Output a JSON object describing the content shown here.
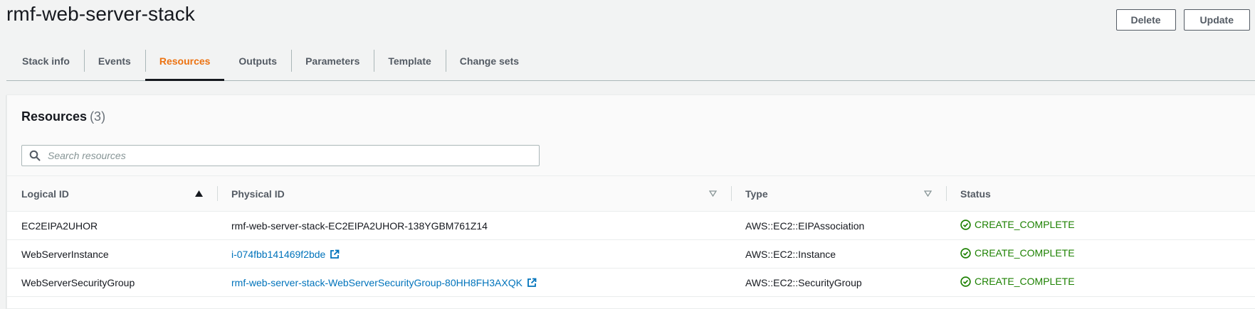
{
  "page": {
    "title": "rmf-web-server-stack"
  },
  "actions": {
    "delete_label": "Delete",
    "update_label": "Update"
  },
  "tabs": [
    {
      "label": "Stack info"
    },
    {
      "label": "Events"
    },
    {
      "label": "Resources",
      "active": true
    },
    {
      "label": "Outputs"
    },
    {
      "label": "Parameters"
    },
    {
      "label": "Template"
    },
    {
      "label": "Change sets"
    }
  ],
  "resources": {
    "title": "Resources",
    "count": "(3)",
    "search": {
      "placeholder": "Search resources",
      "value": ""
    },
    "columns": {
      "logical_id": "Logical ID",
      "physical_id": "Physical ID",
      "type": "Type",
      "status": "Status"
    },
    "sort": {
      "column": "Logical ID",
      "direction": "ascending"
    },
    "rows": [
      {
        "logical_id": "EC2EIPA2UHOR",
        "physical_id": "rmf-web-server-stack-EC2EIPA2UHOR-138YGBM761Z14",
        "physical_is_link": false,
        "type": "AWS::EC2::EIPAssociation",
        "status": "CREATE_COMPLETE"
      },
      {
        "logical_id": "WebServerInstance",
        "physical_id": "i-074fbb141469f2bde",
        "physical_is_link": true,
        "type": "AWS::EC2::Instance",
        "status": "CREATE_COMPLETE"
      },
      {
        "logical_id": "WebServerSecurityGroup",
        "physical_id": "rmf-web-server-stack-WebServerSecurityGroup-80HH8FH3AXQK",
        "physical_is_link": true,
        "type": "AWS::EC2::SecurityGroup",
        "status": "CREATE_COMPLETE"
      }
    ]
  },
  "icons": {
    "search": "search-icon",
    "sort_asc": "sort-ascending-icon",
    "filter": "filter-triangle-icon",
    "external": "external-link-icon",
    "status": "status-success-icon"
  },
  "colors": {
    "accent_tab": "#ec7211",
    "link": "#0073bb",
    "success": "#1d8102",
    "text": "#16191f"
  }
}
